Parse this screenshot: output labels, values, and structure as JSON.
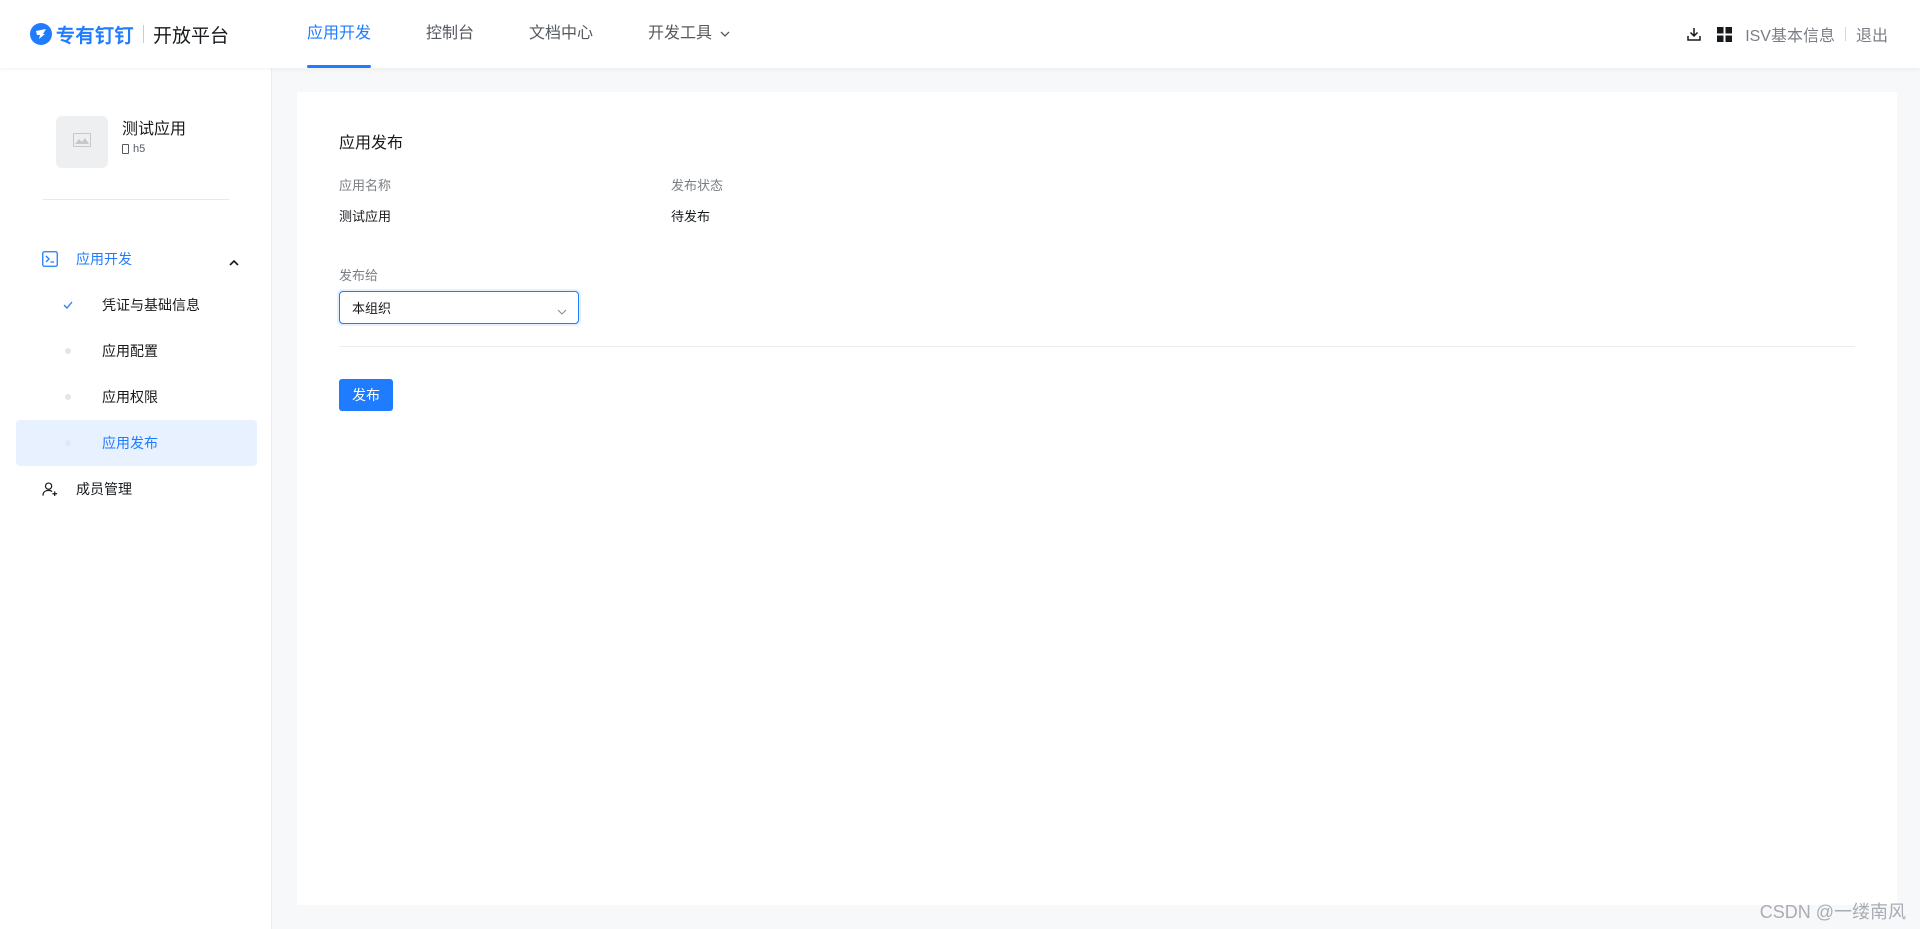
{
  "header": {
    "brand": "专有钉钉",
    "platform": "开放平台",
    "nav": [
      {
        "label": "应用开发",
        "active": true
      },
      {
        "label": "控制台",
        "active": false
      },
      {
        "label": "文档中心",
        "active": false
      },
      {
        "label": "开发工具",
        "active": false,
        "has_dropdown": true
      }
    ],
    "right": {
      "download_icon": "download-icon",
      "grid_icon": "grid-icon",
      "isv_info": "ISV基本信息",
      "logout": "退出"
    }
  },
  "sidebar": {
    "app": {
      "name": "测试应用",
      "type": "h5"
    },
    "group": {
      "label": "应用开发",
      "expanded": true,
      "items": [
        {
          "label": "凭证与基础信息",
          "state": "done"
        },
        {
          "label": "应用配置",
          "state": "pending"
        },
        {
          "label": "应用权限",
          "state": "pending"
        },
        {
          "label": "应用发布",
          "state": "active"
        }
      ]
    },
    "member": {
      "label": "成员管理"
    }
  },
  "main": {
    "title": "应用发布",
    "fields": {
      "app_name_label": "应用名称",
      "app_name_value": "测试应用",
      "status_label": "发布状态",
      "status_value": "待发布"
    },
    "publish_to": {
      "label": "发布给",
      "selected": "本组织"
    },
    "publish_button": "发布"
  },
  "watermark": "CSDN @一缕南风",
  "colors": {
    "accent": "#1f7cff",
    "active_bg": "#e8f1ff",
    "page_bg": "#f7f8fa"
  }
}
